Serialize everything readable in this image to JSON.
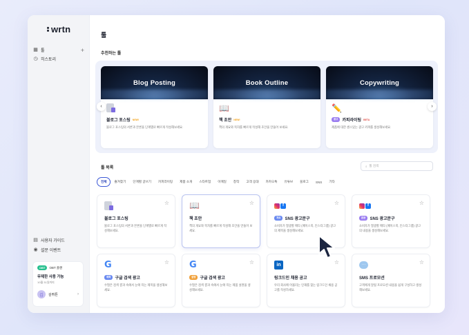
{
  "sidebar": {
    "logo": "wrtn",
    "nav": [
      {
        "label": "툴",
        "icon": "grid-icon"
      },
      {
        "label": "히스토리",
        "icon": "history-icon"
      }
    ],
    "footer_links": [
      {
        "label": "사용자 가이드",
        "icon": "guide-icon"
      },
      {
        "label": "설문 이벤트",
        "icon": "survey-icon"
      }
    ],
    "promo": {
      "badge": "OBT",
      "badge_text": "OBT 플랜",
      "title": "무제한 사용 가능",
      "subtitle": "10월 31일까지",
      "user_name": "김뤼튼",
      "avatar_initial": "김"
    }
  },
  "main": {
    "title": "툴",
    "recommended_title": "추천하는 툴",
    "recommended": [
      {
        "banner": "Blog Posting",
        "name": "블로그 포스팅",
        "tag": "NEW!",
        "desc": "블로그 포스팅의 서론과 본론을 단계별로 빠르게 작성해보세요.",
        "icon": "document-icon"
      },
      {
        "banner": "Book Outline",
        "name": "책 초안",
        "tag": "NEW!",
        "desc": "책의 개요와 목차를 빠르게 작성해 초안을 만들어 보세요.",
        "icon": "book-icon"
      },
      {
        "banner": "Copywriting",
        "pill": "광고",
        "name": "카피라이팅",
        "tag": "BETA",
        "desc": "제품에 대한 센스있는 광고 카피를 생성해보세요.",
        "icon": "pencil-icon"
      }
    ],
    "tools_title": "툴 목록",
    "search_placeholder": "툴 검색",
    "tabs": [
      "전체",
      "즐겨찾기",
      "단계별 글쓰기",
      "카피라이팅",
      "제품 소개",
      "스타트업",
      "이메일",
      "창작",
      "고객 응대",
      "카카오톡",
      "유튜브",
      "블로그",
      "SNS",
      "기타"
    ],
    "tools": [
      {
        "name": "블로그 포스팅",
        "desc": "블로그 포스팅의 서론과 본론을 단계별로 빠르게 작성해보세요.",
        "icon": "document-icon"
      },
      {
        "name": "책 초안",
        "desc": "책의 개요와 목차를 빠르게 작성해 초안을 만들어 보세요.",
        "icon": "book-icon"
      },
      {
        "pill": "개요",
        "name": "SNS 광고문구",
        "desc": "소비자가 열광할 매타 (페이스북, 인스타그램) 광고의 제목을 생성해보세요.",
        "icon": "instagram-facebook-icon"
      },
      {
        "pill": "본문",
        "name": "SNS 광고문구",
        "desc": "소비자가 열광할 메타 (페이스북, 인스타그램) 광고의 내용을 생성해보세요.",
        "icon": "instagram-facebook-icon"
      },
      {
        "pill": "제목",
        "name": "구글 검색 광고",
        "desc": "수많은 검색 결과 속에서 눈에 띄는 제목을 생성해보세요.",
        "icon": "google-icon"
      },
      {
        "pill": "설명",
        "name": "구글 검색 광고",
        "desc": "수많은 검색 결과 속에서 눈에 띄는 제품 설명을 생성해보세요.",
        "icon": "google-icon"
      },
      {
        "name": "링크드인 채용 공고",
        "desc": "우리 회사에 어울리는 인재를 찾는 링크드인 채용 공고를 작성하세요.",
        "icon": "linkedin-icon"
      },
      {
        "name": "SMS 프로모션",
        "desc": "고객에게 알릴 프로모션 내용을 쉽게 구성하고 생성해보세요.",
        "icon": "sms-icon"
      }
    ]
  },
  "colors": {
    "accent": "#3a57d6",
    "new_tag": "#f3a21a",
    "beta_tag": "#e0524a",
    "pill_purple": "#9a7cf0",
    "pill_blue": "#6a8af0",
    "pill_orange": "#f0a03a"
  }
}
